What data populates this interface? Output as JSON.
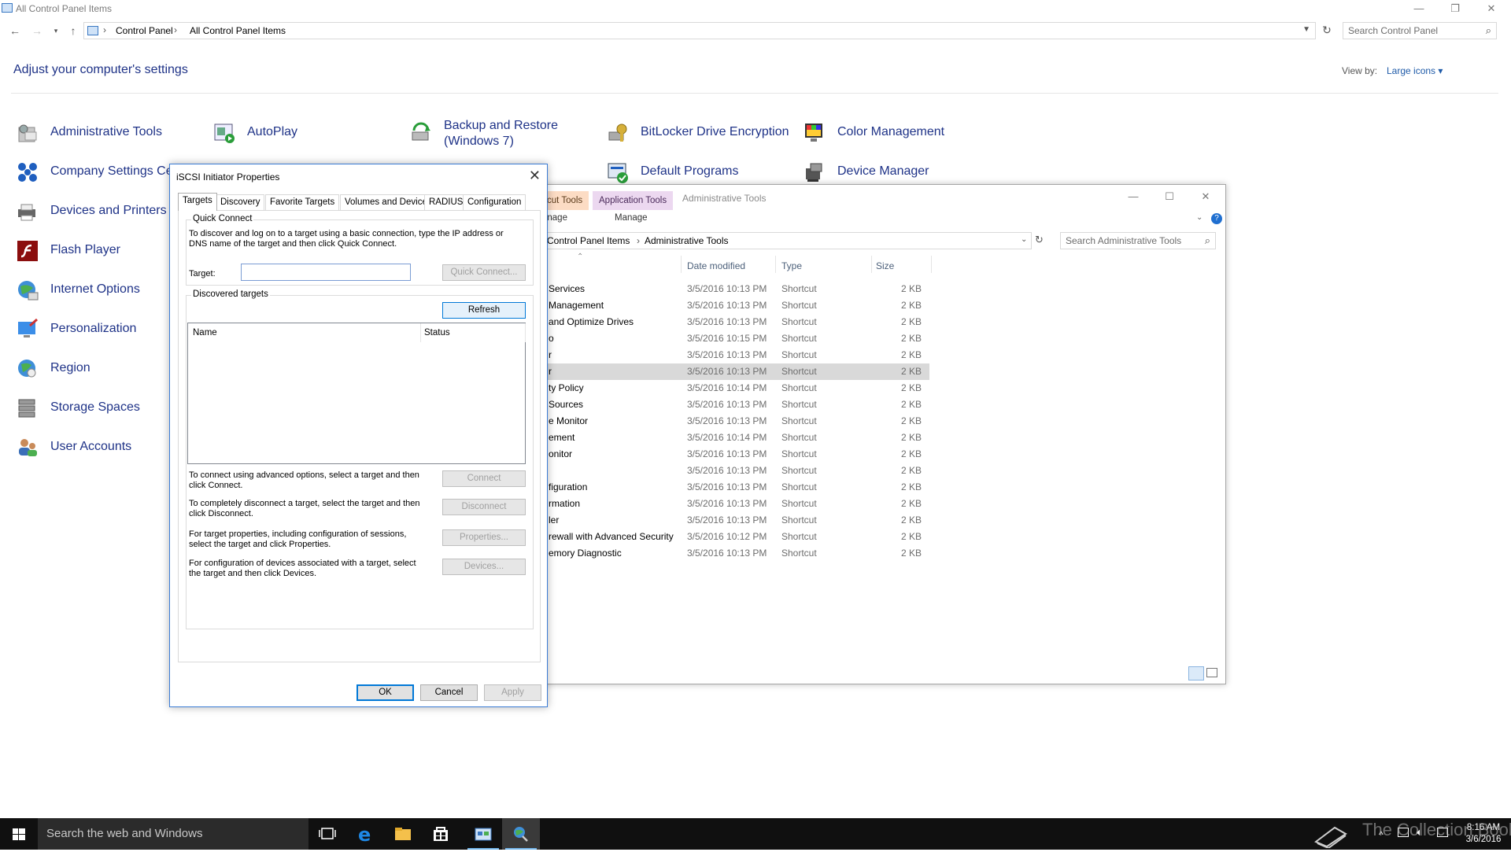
{
  "window": {
    "title": "All Control Panel Items",
    "controls": {
      "minimize": "—",
      "restore": "❐",
      "close": "✕"
    }
  },
  "address_bar": {
    "crumbs": [
      "Control Panel",
      "All Control Panel Items"
    ],
    "search_placeholder": "Search Control Panel"
  },
  "main": {
    "heading": "Adjust your computer's settings",
    "view_by_label": "View by:",
    "view_by_value": "Large icons ▾",
    "items": [
      {
        "label": "Administrative Tools",
        "icon": "admin-tools-icon"
      },
      {
        "label": "AutoPlay",
        "icon": "autoplay-icon"
      },
      {
        "label": "Backup and Restore",
        "label2": "(Windows 7)",
        "icon": "backup-icon"
      },
      {
        "label": "BitLocker Drive Encryption",
        "icon": "bitlocker-icon"
      },
      {
        "label": "Color Management",
        "icon": "color-management-icon"
      },
      {
        "label": "Company Settings Cer",
        "icon": "company-settings-icon"
      },
      {
        "label": "Default Programs",
        "icon": "default-programs-icon"
      },
      {
        "label": "Device Manager",
        "icon": "device-manager-icon"
      },
      {
        "label": "Devices and Printers",
        "icon": "devices-printers-icon"
      },
      {
        "label": "Flash Player",
        "icon": "flash-player-icon"
      },
      {
        "label": "Internet Options",
        "icon": "internet-options-icon"
      },
      {
        "label": "Personalization",
        "icon": "personalization-icon"
      },
      {
        "label": "Region",
        "icon": "region-icon"
      },
      {
        "label": "Storage Spaces",
        "icon": "storage-spaces-icon"
      },
      {
        "label": "User Accounts",
        "icon": "user-accounts-icon"
      }
    ]
  },
  "admin_window": {
    "tabs": [
      "cut Tools",
      "Application Tools"
    ],
    "title": "Administrative Tools",
    "sub_tabs": [
      "anage",
      "Manage"
    ],
    "crumbs": [
      "Control Panel Items",
      "Administrative Tools"
    ],
    "search_placeholder": "Search Administrative Tools",
    "columns": [
      "Date modified",
      "Type",
      "Size"
    ],
    "rows": [
      {
        "name": "Services",
        "date": "3/5/2016 10:13 PM",
        "type": "Shortcut",
        "size": "2 KB"
      },
      {
        "name": "Management",
        "date": "3/5/2016 10:13 PM",
        "type": "Shortcut",
        "size": "2 KB"
      },
      {
        "name": "and Optimize Drives",
        "date": "3/5/2016 10:13 PM",
        "type": "Shortcut",
        "size": "2 KB"
      },
      {
        "name": "o",
        "date": "3/5/2016 10:15 PM",
        "type": "Shortcut",
        "size": "2 KB"
      },
      {
        "name": "r",
        "date": "3/5/2016 10:13 PM",
        "type": "Shortcut",
        "size": "2 KB"
      },
      {
        "name": "r",
        "date": "3/5/2016 10:13 PM",
        "type": "Shortcut",
        "size": "2 KB"
      },
      {
        "name": "ty Policy",
        "date": "3/5/2016 10:14 PM",
        "type": "Shortcut",
        "size": "2 KB"
      },
      {
        "name": "Sources",
        "date": "3/5/2016 10:13 PM",
        "type": "Shortcut",
        "size": "2 KB"
      },
      {
        "name": "e Monitor",
        "date": "3/5/2016 10:13 PM",
        "type": "Shortcut",
        "size": "2 KB"
      },
      {
        "name": "ement",
        "date": "3/5/2016 10:14 PM",
        "type": "Shortcut",
        "size": "2 KB"
      },
      {
        "name": "onitor",
        "date": "3/5/2016 10:13 PM",
        "type": "Shortcut",
        "size": "2 KB"
      },
      {
        "name": "",
        "date": "3/5/2016 10:13 PM",
        "type": "Shortcut",
        "size": "2 KB"
      },
      {
        "name": "figuration",
        "date": "3/5/2016 10:13 PM",
        "type": "Shortcut",
        "size": "2 KB"
      },
      {
        "name": "rmation",
        "date": "3/5/2016 10:13 PM",
        "type": "Shortcut",
        "size": "2 KB"
      },
      {
        "name": "ler",
        "date": "3/5/2016 10:13 PM",
        "type": "Shortcut",
        "size": "2 KB"
      },
      {
        "name": "rewall with Advanced Security",
        "date": "3/5/2016 10:12 PM",
        "type": "Shortcut",
        "size": "2 KB"
      },
      {
        "name": "emory Diagnostic",
        "date": "3/5/2016 10:13 PM",
        "type": "Shortcut",
        "size": "2 KB"
      }
    ]
  },
  "iscsi": {
    "title": "iSCSI Initiator Properties",
    "tabs": [
      "Targets",
      "Discovery",
      "Favorite Targets",
      "Volumes and Devices",
      "RADIUS",
      "Configuration"
    ],
    "quick_connect": {
      "title": "Quick Connect",
      "description": "To discover and log on to a target using a basic connection, type the IP address or DNS name of the target and then click Quick Connect.",
      "target_label": "Target:",
      "target_value": "",
      "button": "Quick Connect..."
    },
    "discovered": {
      "title": "Discovered targets",
      "refresh": "Refresh",
      "columns": [
        "Name",
        "Status"
      ]
    },
    "actions": [
      {
        "text": "To connect using advanced options, select a target and then click Connect.",
        "button": "Connect"
      },
      {
        "text": "To completely disconnect a target, select the target and then click Disconnect.",
        "button": "Disconnect"
      },
      {
        "text": "For target properties, including configuration of sessions, select the target and click Properties.",
        "button": "Properties..."
      },
      {
        "text": "For configuration of devices associated with a target, select the target and then click Devices.",
        "button": "Devices..."
      }
    ],
    "footer": {
      "ok": "OK",
      "cancel": "Cancel",
      "apply": "Apply"
    }
  },
  "taskbar": {
    "search_placeholder": "Search the web and Windows",
    "time": "8:16 AM",
    "date": "3/6/2016",
    "watermark": "The Collection Book"
  },
  "colors": {
    "accent": "#0078d7",
    "link": "#1e3287",
    "taskbar": "#101010"
  }
}
